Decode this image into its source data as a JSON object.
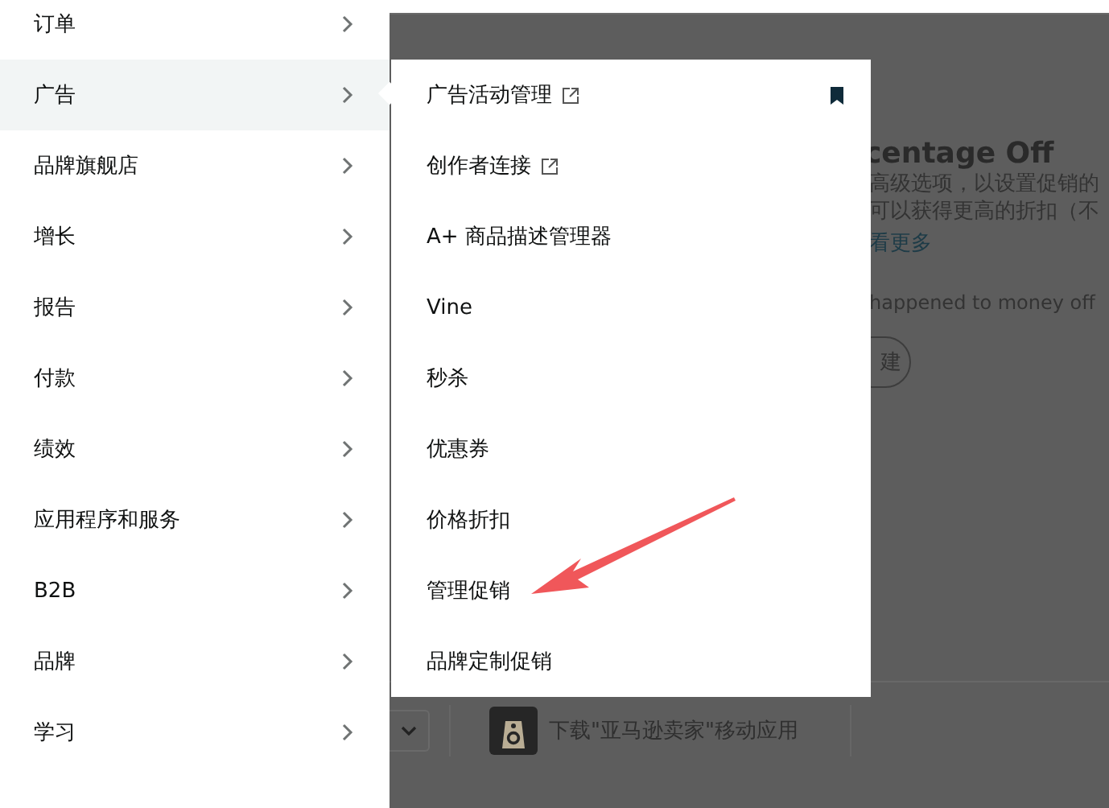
{
  "sidebar": {
    "items": [
      {
        "label": "订单",
        "selected": false
      },
      {
        "label": "广告",
        "selected": true
      },
      {
        "label": "品牌旗舰店",
        "selected": false
      },
      {
        "label": "增长",
        "selected": false
      },
      {
        "label": "报告",
        "selected": false
      },
      {
        "label": "付款",
        "selected": false
      },
      {
        "label": "绩效",
        "selected": false
      },
      {
        "label": "应用程序和服务",
        "selected": false
      },
      {
        "label": "B2B",
        "selected": false
      },
      {
        "label": "品牌",
        "selected": false
      },
      {
        "label": "学习",
        "selected": false
      }
    ]
  },
  "submenu": {
    "items": [
      {
        "label": "广告活动管理",
        "external": true,
        "bookmarked": true
      },
      {
        "label": "创作者连接",
        "external": true,
        "bookmarked": false
      },
      {
        "label": "A+ 商品描述管理器",
        "external": false,
        "bookmarked": false
      },
      {
        "label": "Vine",
        "external": false,
        "bookmarked": false
      },
      {
        "label": "秒杀",
        "external": false,
        "bookmarked": false
      },
      {
        "label": "优惠券",
        "external": false,
        "bookmarked": false
      },
      {
        "label": "价格折扣",
        "external": false,
        "bookmarked": false
      },
      {
        "label": "管理促销",
        "external": false,
        "bookmarked": false
      },
      {
        "label": "品牌定制促销",
        "external": false,
        "bookmarked": false
      }
    ]
  },
  "page": {
    "heading": "centage Off",
    "description": [
      "高级选项，以设置促销的",
      "可以获得更高的折扣（不"
    ],
    "link": "看更多",
    "question": "happened to money off",
    "button": "建"
  },
  "footer": {
    "app_download": "下载\"亚马逊卖家\"移动应用"
  }
}
